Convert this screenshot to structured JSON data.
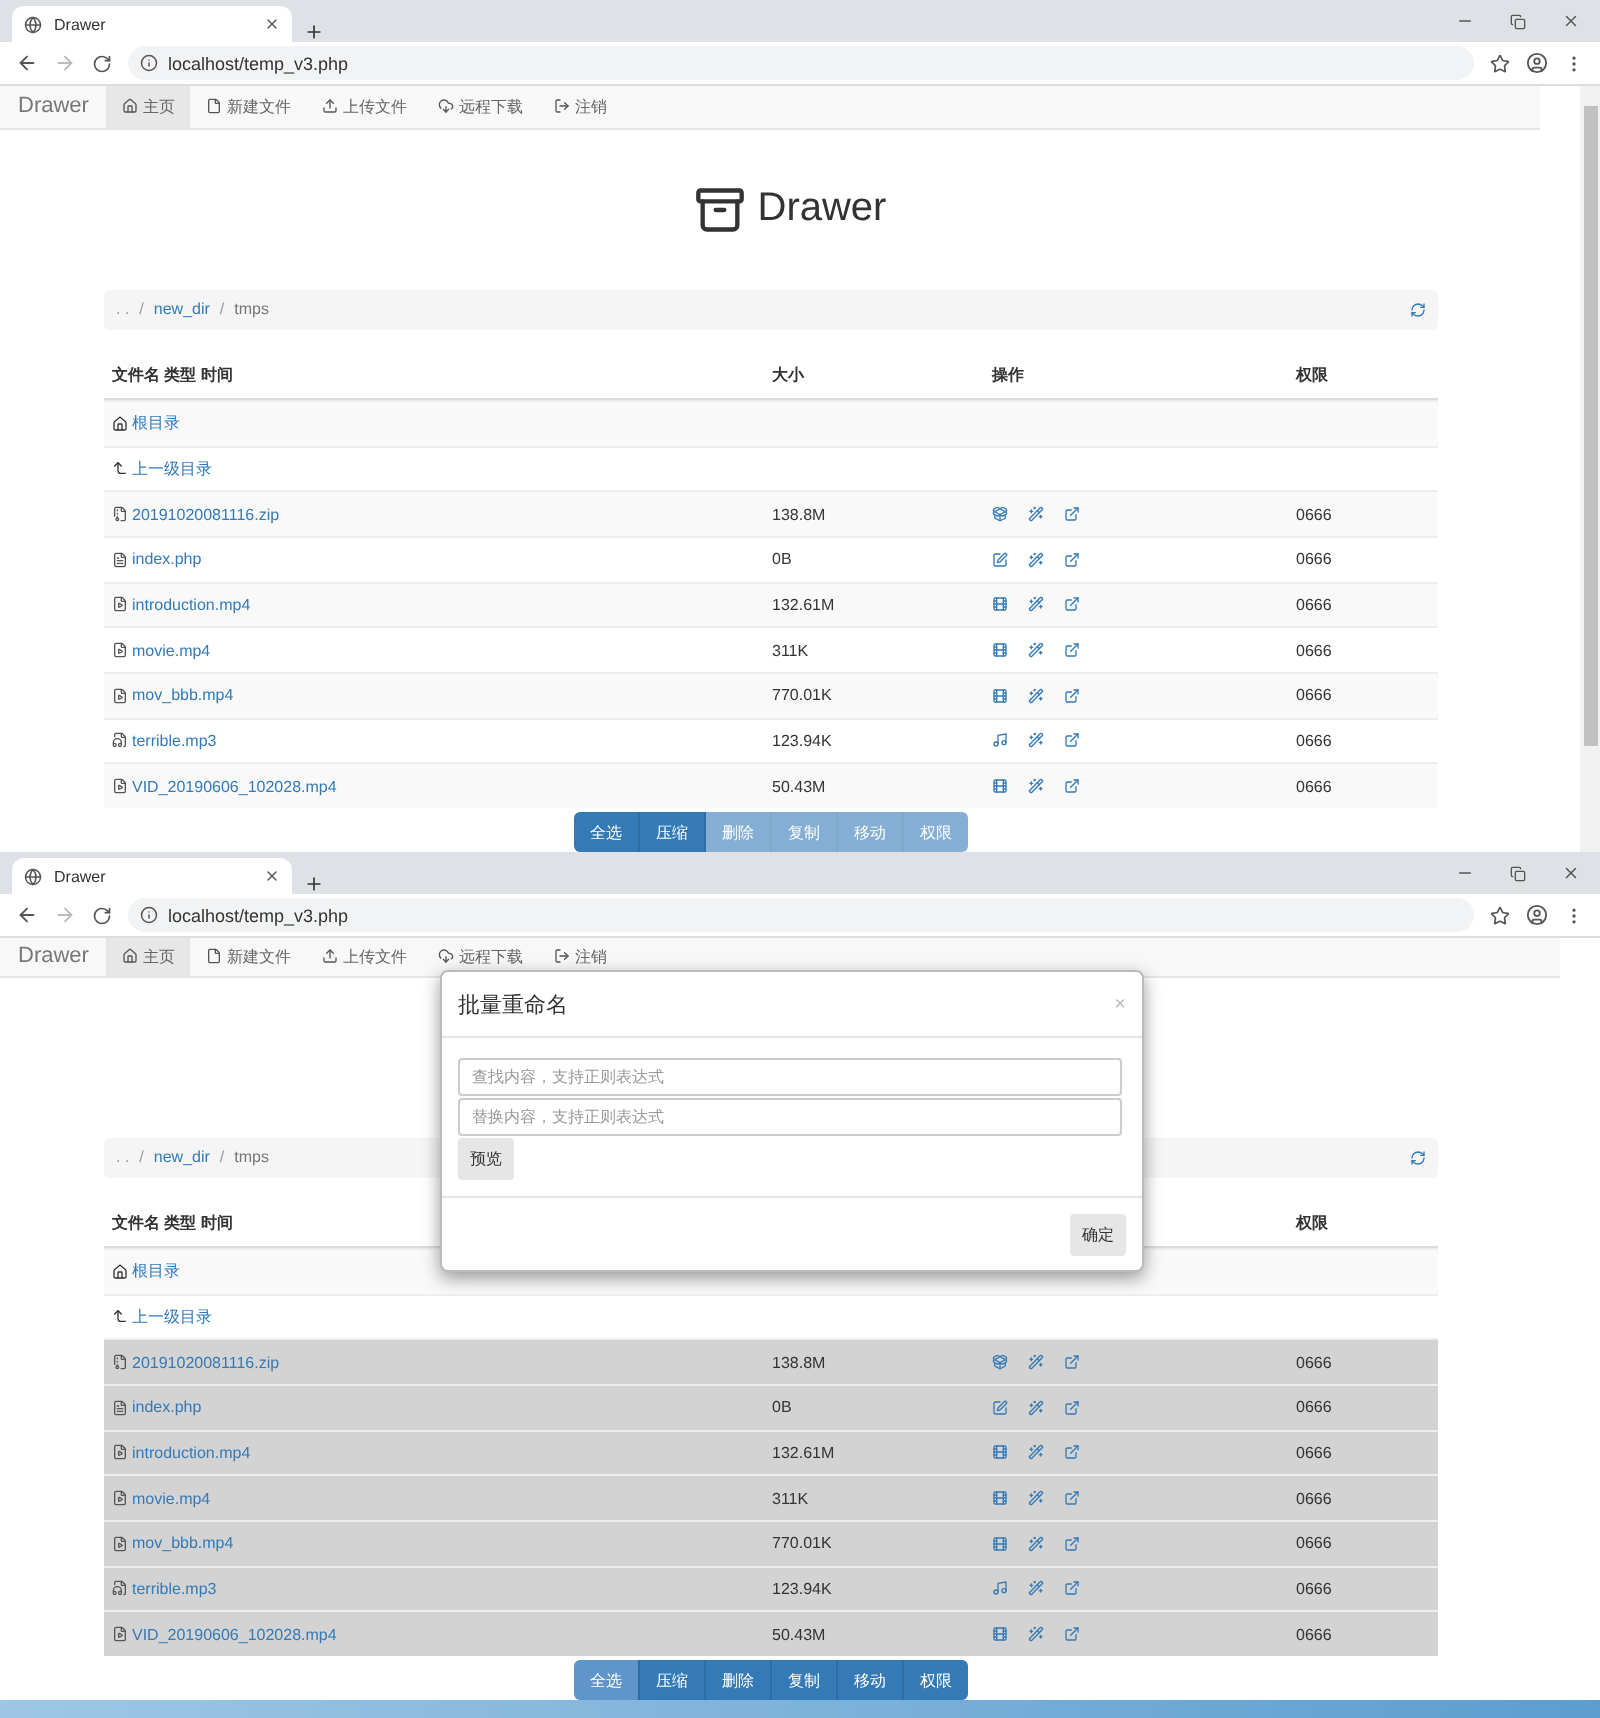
{
  "screens": [
    {
      "tab_title": "Drawer",
      "url": "localhost/temp_v3.php",
      "nav": {
        "brand": "Drawer",
        "items": [
          {
            "label": "主页",
            "selected": true
          },
          {
            "label": "新建文件",
            "selected": false
          },
          {
            "label": "上传文件",
            "selected": false
          },
          {
            "label": "远程下载",
            "selected": false
          },
          {
            "label": "注销",
            "selected": false
          }
        ]
      },
      "heading": "Drawer",
      "breadcrumb": {
        "separator": "/",
        "items": [
          ". .",
          "new_dir",
          "tmps"
        ]
      },
      "columns": [
        {
          "label": "文件名 类型 时间",
          "kind": "name"
        },
        {
          "label": "大小",
          "kind": "size"
        },
        {
          "label": "操作",
          "kind": "ops"
        },
        {
          "label": "权限",
          "kind": "perm"
        }
      ],
      "nav_rows": [
        {
          "label": "根目录",
          "kind": "root"
        },
        {
          "label": "上一级目录",
          "kind": "up"
        }
      ],
      "files": [
        {
          "name": "20191020081116.zip",
          "size": "138.8M",
          "perm": "0666",
          "kind": "archive",
          "selected": false
        },
        {
          "name": "index.php",
          "size": "0B",
          "perm": "0666",
          "kind": "text",
          "selected": false
        },
        {
          "name": "introduction.mp4",
          "size": "132.61M",
          "perm": "0666",
          "kind": "video",
          "selected": false
        },
        {
          "name": "movie.mp4",
          "size": "311K",
          "perm": "0666",
          "kind": "video",
          "selected": false
        },
        {
          "name": "mov_bbb.mp4",
          "size": "770.01K",
          "perm": "0666",
          "kind": "video",
          "selected": false
        },
        {
          "name": "terrible.mp3",
          "size": "123.94K",
          "perm": "0666",
          "kind": "audio",
          "selected": false
        },
        {
          "name": "VID_20190606_102028.mp4",
          "size": "50.43M",
          "perm": "0666",
          "kind": "video",
          "selected": false
        }
      ],
      "actions": [
        {
          "label": "全选",
          "disabled": false,
          "active": false
        },
        {
          "label": "压缩",
          "disabled": false,
          "active": false
        },
        {
          "label": "删除",
          "disabled": true,
          "active": false
        },
        {
          "label": "复制",
          "disabled": true,
          "active": false
        },
        {
          "label": "移动",
          "disabled": true,
          "active": false
        },
        {
          "label": "权限",
          "disabled": true,
          "active": false
        }
      ]
    },
    {
      "tab_title": "Drawer",
      "url": "localhost/temp_v3.php",
      "nav": {
        "brand": "Drawer",
        "items": [
          {
            "label": "主页",
            "selected": true
          },
          {
            "label": "新建文件",
            "selected": false
          },
          {
            "label": "上传文件",
            "selected": false
          },
          {
            "label": "远程下载",
            "selected": false
          },
          {
            "label": "注销",
            "selected": false
          }
        ]
      },
      "breadcrumb": {
        "separator": "/",
        "items": [
          ". .",
          "new_dir",
          "tmps"
        ]
      },
      "columns": [
        {
          "label": "文件名 类型 时间",
          "kind": "name"
        },
        {
          "label": "权限",
          "kind": "perm"
        }
      ],
      "nav_rows": [
        {
          "label": "根目录",
          "kind": "root"
        },
        {
          "label": "上一级目录",
          "kind": "up"
        }
      ],
      "files": [
        {
          "name": "20191020081116.zip",
          "size": "138.8M",
          "perm": "0666",
          "kind": "archive",
          "selected": true
        },
        {
          "name": "index.php",
          "size": "0B",
          "perm": "0666",
          "kind": "text",
          "selected": true
        },
        {
          "name": "introduction.mp4",
          "size": "132.61M",
          "perm": "0666",
          "kind": "video",
          "selected": true
        },
        {
          "name": "movie.mp4",
          "size": "311K",
          "perm": "0666",
          "kind": "video",
          "selected": true
        },
        {
          "name": "mov_bbb.mp4",
          "size": "770.01K",
          "perm": "0666",
          "kind": "video",
          "selected": true
        },
        {
          "name": "terrible.mp3",
          "size": "123.94K",
          "perm": "0666",
          "kind": "audio",
          "selected": true
        },
        {
          "name": "VID_20190606_102028.mp4",
          "size": "50.43M",
          "perm": "0666",
          "kind": "video",
          "selected": true
        }
      ],
      "actions": [
        {
          "label": "全选",
          "disabled": false,
          "active": true
        },
        {
          "label": "压缩",
          "disabled": false,
          "active": false
        },
        {
          "label": "删除",
          "disabled": false,
          "active": false
        },
        {
          "label": "复制",
          "disabled": false,
          "active": false
        },
        {
          "label": "移动",
          "disabled": false,
          "active": false
        },
        {
          "label": "权限",
          "disabled": false,
          "active": false
        }
      ],
      "dialog": {
        "title": "批量重命名",
        "close": "×",
        "find_placeholder": "查找内容，支持正则表达式",
        "replace_placeholder": "替换内容，支持正则表达式",
        "preview": "预览",
        "confirm": "确定"
      }
    }
  ]
}
